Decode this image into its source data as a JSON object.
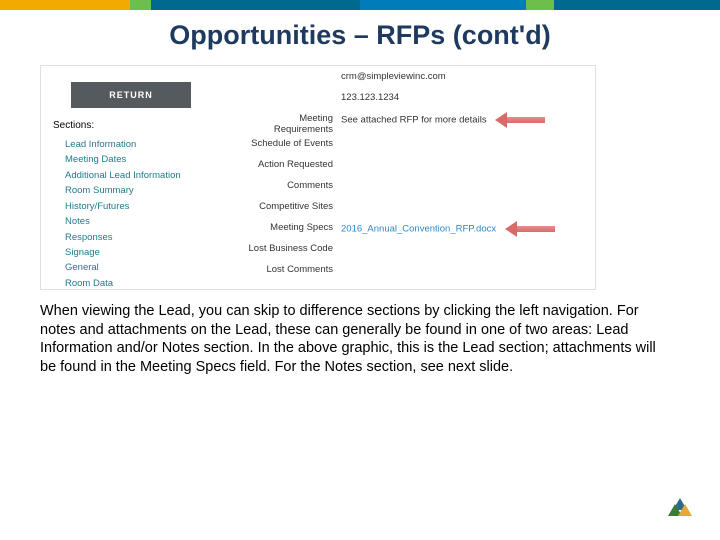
{
  "title": "Opportunities – RFPs (cont'd)",
  "screenshot": {
    "return_button": "RETURN",
    "sections_heading": "Sections:",
    "sections": {
      "s0": "Lead Information",
      "s1": "Meeting Dates",
      "s2": "Additional Lead Information",
      "s3": "Room Summary",
      "s4": "History/Futures",
      "s5": "Notes",
      "s6": "Responses",
      "s7": "Signage",
      "s8": "General",
      "s9": "Room Data"
    },
    "details": {
      "contact_email": "crm@simpleviewinc.com",
      "contact_phone": "123.123.1234",
      "meeting_requirements_label": "Meeting Requirements",
      "meeting_requirements_value": "See attached RFP for more details",
      "schedule_label": "Schedule of Events",
      "action_label": "Action Requested",
      "comments_label": "Comments",
      "competitive_label": "Competitive Sites",
      "specs_label": "Meeting Specs",
      "specs_value": "2016_Annual_Convention_RFP.docx",
      "lost_code_label": "Lost Business Code",
      "lost_comments_label": "Lost Comments"
    }
  },
  "body_text": "When viewing the Lead, you can skip to difference sections by clicking the left navigation.  For notes and attachments on the Lead, these can generally be found in one of two areas: Lead Information and/or Notes section.  In the above graphic, this is the Lead section; attachments will be found in the Meeting Specs field.  For the Notes section, see next slide."
}
